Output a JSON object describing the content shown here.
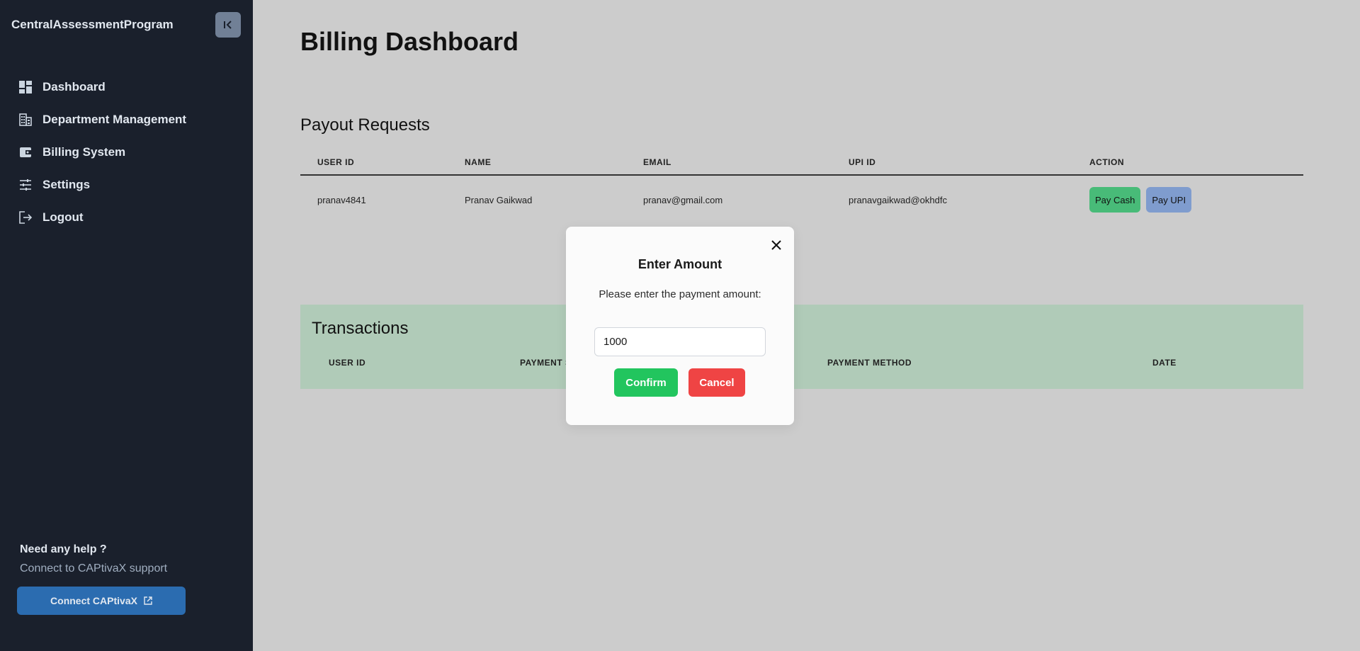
{
  "sidebar": {
    "brand": "CentralAssessmentProgram",
    "items": [
      {
        "label": "Dashboard",
        "icon": "dashboard-icon"
      },
      {
        "label": "Department Management",
        "icon": "building-icon"
      },
      {
        "label": "Billing System",
        "icon": "wallet-icon"
      },
      {
        "label": "Settings",
        "icon": "sliders-icon"
      },
      {
        "label": "Logout",
        "icon": "logout-icon"
      }
    ],
    "help_title": "Need any help ?",
    "help_subtitle": "Connect to CAPtivaX support",
    "connect_label": "Connect CAPtivaX"
  },
  "main": {
    "title": "Billing Dashboard",
    "payout": {
      "title": "Payout Requests",
      "headers": [
        "USER ID",
        "NAME",
        "EMAIL",
        "UPI ID",
        "ACTION"
      ],
      "rows": [
        {
          "user_id": "pranav4841",
          "name": "Pranav Gaikwad",
          "email": "pranav@gmail.com",
          "upi_id": "pranavgaikwad@okhdfc",
          "pay_cash": "Pay Cash",
          "pay_upi": "Pay UPI"
        }
      ]
    },
    "transactions": {
      "title": "Transactions",
      "headers": [
        "USER ID",
        "PAYMENT STATUS",
        "PAYMENT METHOD",
        "DATE"
      ]
    }
  },
  "modal": {
    "title": "Enter Amount",
    "description": "Please enter the payment amount:",
    "amount_value": "1000",
    "confirm_label": "Confirm",
    "cancel_label": "Cancel"
  },
  "colors": {
    "sidebar_bg": "#1a202c",
    "page_bg": "#cccccc",
    "pay_cash": "#48bb78",
    "pay_upi": "#7f9cce",
    "transactions_bg": "#b0cbb8",
    "confirm": "#22c55e",
    "cancel": "#ef4444",
    "connect": "#2b6cb0"
  }
}
